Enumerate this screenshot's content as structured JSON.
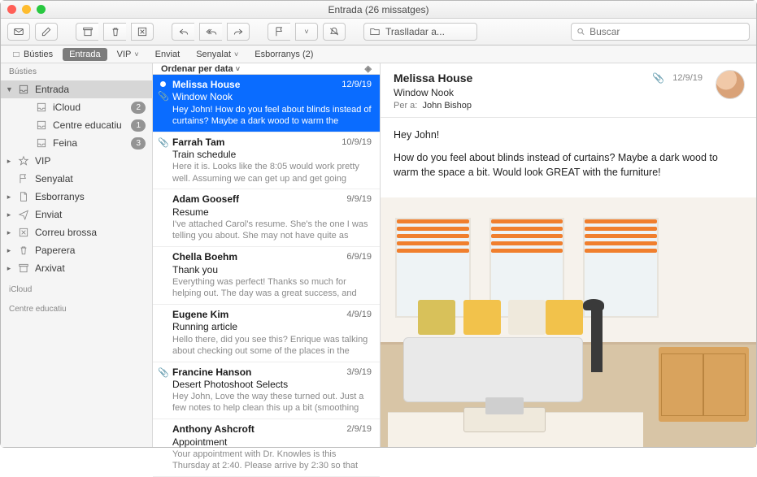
{
  "window": {
    "title": "Entrada (26 missatges)"
  },
  "toolbar": {
    "move_label": "Traslladar a...",
    "search_placeholder": "Buscar"
  },
  "favbar": {
    "mailboxes": "Bústies",
    "inbox": "Entrada",
    "vip": "VIP",
    "sent": "Enviat",
    "flagged": "Senyalat",
    "drafts": "Esborranys (2)"
  },
  "sidebar": {
    "header": "Bústies",
    "items": [
      {
        "label": "Entrada",
        "kind": "inbox",
        "selected": true,
        "expandable": true
      },
      {
        "label": "iCloud",
        "kind": "child",
        "badge": "2"
      },
      {
        "label": "Centre educatiu",
        "kind": "child",
        "badge": "1"
      },
      {
        "label": "Feina",
        "kind": "child",
        "badge": "3"
      },
      {
        "label": "VIP",
        "kind": "vip",
        "expandable": true
      },
      {
        "label": "Senyalat",
        "kind": "flag"
      },
      {
        "label": "Esborranys",
        "kind": "drafts",
        "expandable": true
      },
      {
        "label": "Enviat",
        "kind": "sent",
        "expandable": true
      },
      {
        "label": "Correu brossa",
        "kind": "junk",
        "expandable": true
      },
      {
        "label": "Paperera",
        "kind": "trash",
        "expandable": true
      },
      {
        "label": "Arxivat",
        "kind": "archive",
        "expandable": true
      }
    ],
    "accounts": [
      "iCloud",
      "Centre educatiu"
    ]
  },
  "msglist": {
    "sort_label": "Ordenar per data",
    "messages": [
      {
        "from": "Melissa House",
        "date": "12/9/19",
        "subject": "Window Nook",
        "preview": "Hey John! How do you feel about blinds instead of curtains? Maybe a dark wood to warm the space…",
        "selected": true,
        "unread": true,
        "attachment": true
      },
      {
        "from": "Farrah Tam",
        "date": "10/9/19",
        "subject": "Train schedule",
        "preview": "Here it is. Looks like the 8:05 would work pretty well. Assuming we can get up and get going that…",
        "attachment": true
      },
      {
        "from": "Adam Gooseff",
        "date": "9/9/19",
        "subject": "Resume",
        "preview": "I've attached Carol's resume. She's the one I was telling you about. She may not have quite as muc…"
      },
      {
        "from": "Chella Boehm",
        "date": "6/9/19",
        "subject": "Thank you",
        "preview": "Everything was perfect! Thanks so much for helping out. The day was a great success, and we…"
      },
      {
        "from": "Eugene Kim",
        "date": "4/9/19",
        "subject": "Running article",
        "preview": "Hello there, did you see this? Enrique was talking about checking out some of the places in the arti…"
      },
      {
        "from": "Francine Hanson",
        "date": "3/9/19",
        "subject": "Desert Photoshoot Selects",
        "preview": "Hey John, Love the way these turned out. Just a few notes to help clean this up a bit (smoothing t…",
        "attachment": true
      },
      {
        "from": "Anthony Ashcroft",
        "date": "2/9/19",
        "subject": "Appointment",
        "preview": "Your appointment with Dr. Knowles is this Thursday at 2:40. Please arrive by 2:30 so that you ca…"
      }
    ]
  },
  "reader": {
    "from": "Melissa House",
    "date": "12/9/19",
    "subject": "Window Nook",
    "to_label": "Per a:",
    "to": "John Bishop",
    "body": [
      "Hey John!",
      "How do you feel about blinds instead of curtains? Maybe a dark wood to warm the space a bit. Would look GREAT with the furniture!"
    ]
  }
}
